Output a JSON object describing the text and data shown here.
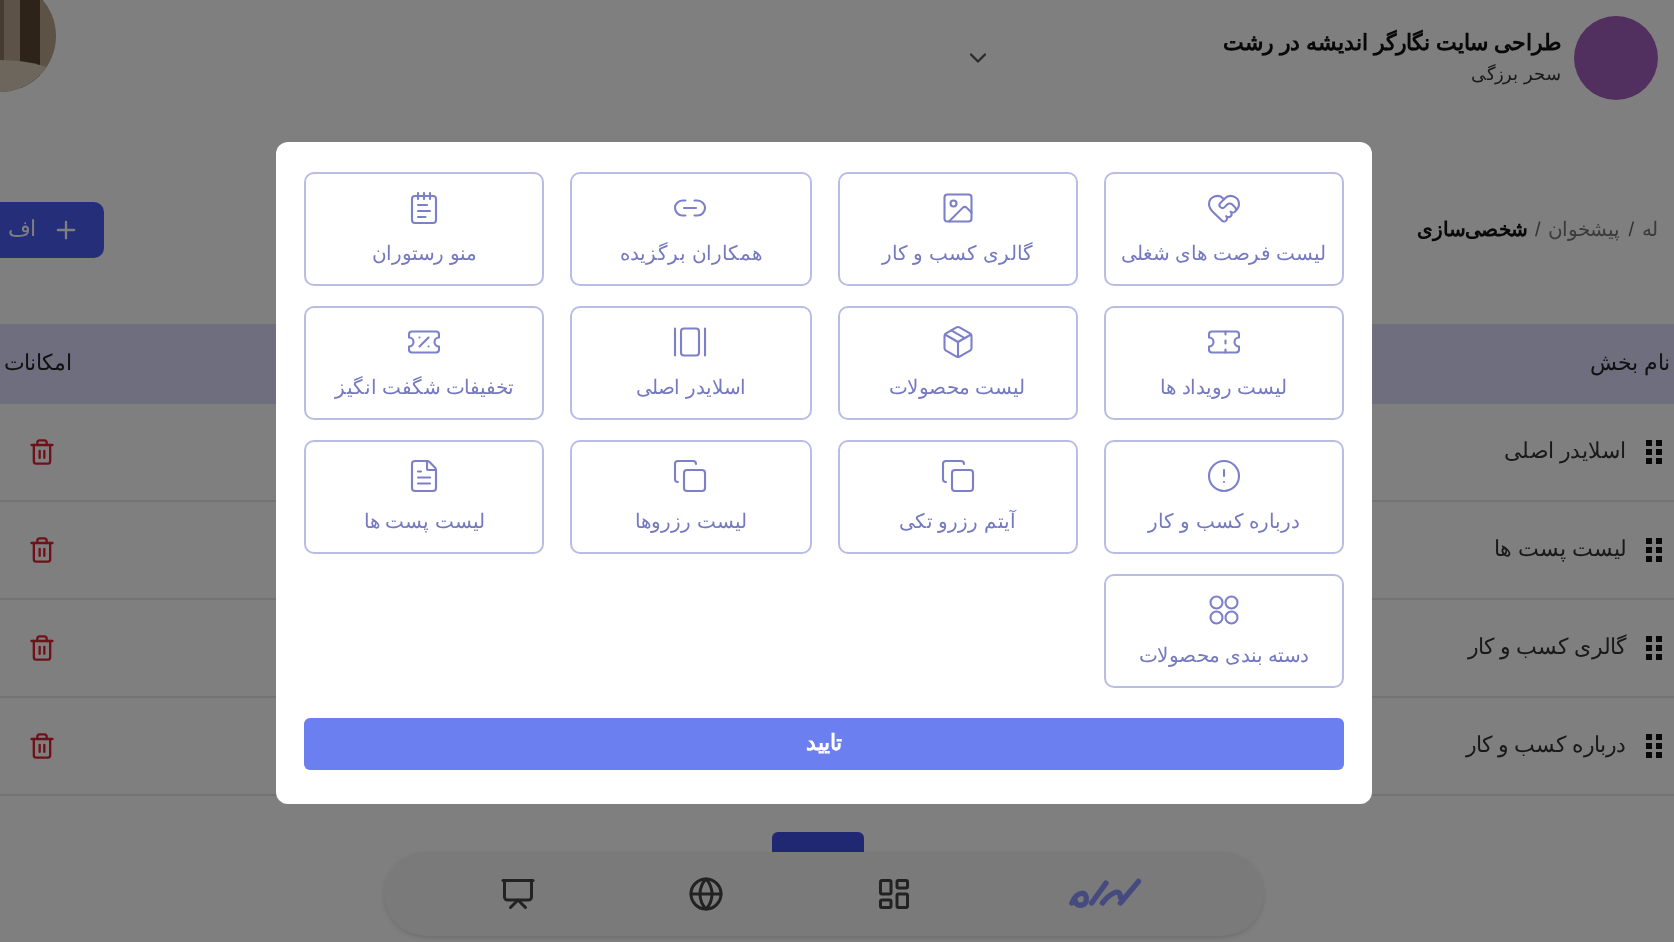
{
  "header": {
    "title": "طراحی سایت نگارگر اندیشه در رشت",
    "subtitle": "سحر برزگی"
  },
  "breadcrumbs": [
    {
      "kind": "link",
      "label": "له",
      "current": false
    },
    {
      "kind": "separator",
      "label": "/"
    },
    {
      "kind": "link",
      "label": "پیشخوان",
      "current": false
    },
    {
      "kind": "separator",
      "label": "/"
    },
    {
      "kind": "link",
      "label": "شخصی‌سازی",
      "current": true
    }
  ],
  "add_button": "اف",
  "table": {
    "columns": [
      "نام بخش",
      "امکانات"
    ],
    "rows": [
      {
        "name": "اسلایدر اصلی"
      },
      {
        "name": "لیست پست ها"
      },
      {
        "name": "گالری کسب و کار"
      },
      {
        "name": "درباره کسب و کار"
      }
    ]
  },
  "dialog": {
    "options": [
      {
        "label": "لیست فرصت های شغلی"
      },
      {
        "label": "گالری کسب و کار"
      },
      {
        "label": "همکاران برگزیده"
      },
      {
        "label": "منو رستوران"
      },
      {
        "label": "لیست رویداد ها"
      },
      {
        "label": "لیست محصولات"
      },
      {
        "label": "اسلایدر اصلی"
      },
      {
        "label": "تخفیفات شگفت انگیز"
      },
      {
        "label": "درباره کسب و کار"
      },
      {
        "label": "آیتم رزرو تکی"
      },
      {
        "label": "لیست رزروها"
      },
      {
        "label": "لیست پست ها"
      },
      {
        "label": "دسته بندی محصولات"
      }
    ],
    "confirm": "تایید"
  }
}
